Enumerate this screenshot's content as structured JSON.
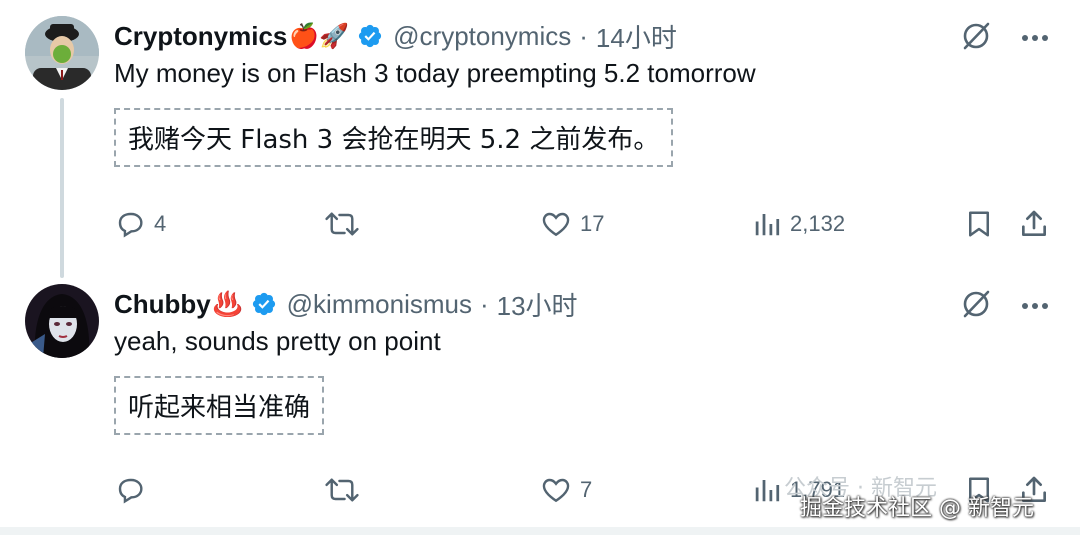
{
  "tweets": [
    {
      "name": "Cryptonymics",
      "name_emoji": "🍎🚀",
      "handle": "@cryptonymics",
      "separator": "·",
      "time": "14小时",
      "text": "My money is on Flash 3 today preempting 5.2 tomorrow",
      "translation": "我赌今天 Flash 3 会抢在明天 5.2 之前发布。",
      "replies": "4",
      "retweets": "",
      "likes": "17",
      "views": "2,132"
    },
    {
      "name": "Chubby",
      "name_emoji": "♨️",
      "handle": "@kimmonismus",
      "separator": "·",
      "time": "13小时",
      "text": "yeah, sounds pretty on point",
      "translation": "听起来相当准确",
      "replies": "",
      "retweets": "",
      "likes": "7",
      "views": "1,791"
    }
  ],
  "watermark": {
    "line1": "公众号 · 新智元",
    "line2": "掘金技术社区 @ 新智元"
  },
  "colors": {
    "text": "#0f1419",
    "muted": "#536471",
    "verified": "#1d9bf0",
    "thread_line": "#cfd9de"
  }
}
